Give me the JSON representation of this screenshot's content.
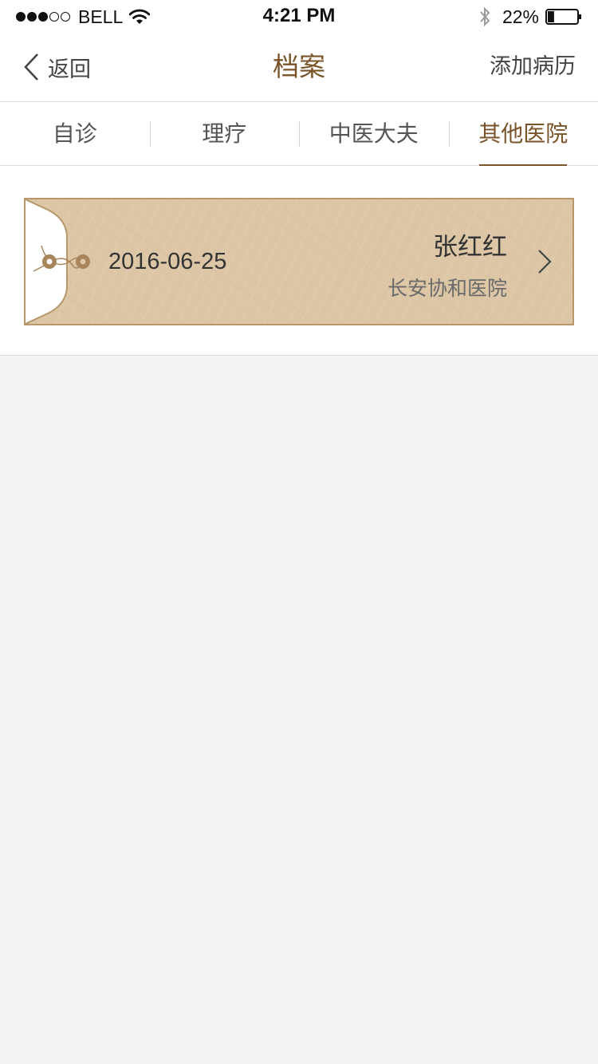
{
  "status_bar": {
    "signal_dots": [
      true,
      true,
      true,
      false,
      false
    ],
    "carrier": "BELL",
    "time": "4:21 PM",
    "battery": "22%",
    "battery_level": 0.22
  },
  "nav": {
    "back_label": "返回",
    "title": "档案",
    "action_label": "添加病历"
  },
  "tabs": [
    {
      "label": "自诊",
      "active": false
    },
    {
      "label": "理疗",
      "active": false
    },
    {
      "label": "中医大夫",
      "active": false
    },
    {
      "label": "其他医院",
      "active": true
    }
  ],
  "records": [
    {
      "date": "2016-06-25",
      "name": "张红红",
      "hospital": "长安协和医院"
    }
  ],
  "colors": {
    "accent": "#7a5428",
    "card_bg": "#dcc6a5",
    "card_border": "#b8976a",
    "page_bg": "#f3f3f3"
  }
}
